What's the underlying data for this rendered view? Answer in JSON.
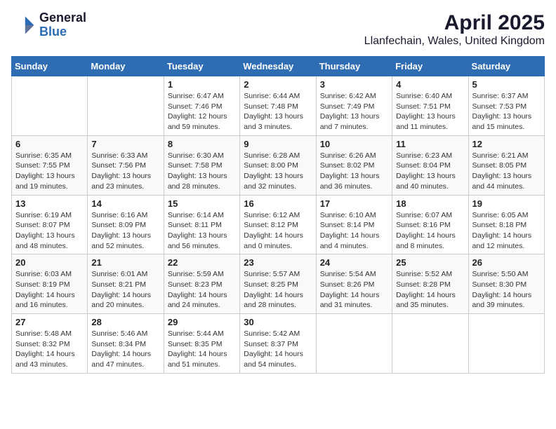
{
  "logo": {
    "general": "General",
    "blue": "Blue"
  },
  "title": "April 2025",
  "subtitle": "Llanfechain, Wales, United Kingdom",
  "days_header": [
    "Sunday",
    "Monday",
    "Tuesday",
    "Wednesday",
    "Thursday",
    "Friday",
    "Saturday"
  ],
  "weeks": [
    [
      {
        "day": "",
        "info": ""
      },
      {
        "day": "",
        "info": ""
      },
      {
        "day": "1",
        "info": "Sunrise: 6:47 AM\nSunset: 7:46 PM\nDaylight: 12 hours\nand 59 minutes."
      },
      {
        "day": "2",
        "info": "Sunrise: 6:44 AM\nSunset: 7:48 PM\nDaylight: 13 hours\nand 3 minutes."
      },
      {
        "day": "3",
        "info": "Sunrise: 6:42 AM\nSunset: 7:49 PM\nDaylight: 13 hours\nand 7 minutes."
      },
      {
        "day": "4",
        "info": "Sunrise: 6:40 AM\nSunset: 7:51 PM\nDaylight: 13 hours\nand 11 minutes."
      },
      {
        "day": "5",
        "info": "Sunrise: 6:37 AM\nSunset: 7:53 PM\nDaylight: 13 hours\nand 15 minutes."
      }
    ],
    [
      {
        "day": "6",
        "info": "Sunrise: 6:35 AM\nSunset: 7:55 PM\nDaylight: 13 hours\nand 19 minutes."
      },
      {
        "day": "7",
        "info": "Sunrise: 6:33 AM\nSunset: 7:56 PM\nDaylight: 13 hours\nand 23 minutes."
      },
      {
        "day": "8",
        "info": "Sunrise: 6:30 AM\nSunset: 7:58 PM\nDaylight: 13 hours\nand 28 minutes."
      },
      {
        "day": "9",
        "info": "Sunrise: 6:28 AM\nSunset: 8:00 PM\nDaylight: 13 hours\nand 32 minutes."
      },
      {
        "day": "10",
        "info": "Sunrise: 6:26 AM\nSunset: 8:02 PM\nDaylight: 13 hours\nand 36 minutes."
      },
      {
        "day": "11",
        "info": "Sunrise: 6:23 AM\nSunset: 8:04 PM\nDaylight: 13 hours\nand 40 minutes."
      },
      {
        "day": "12",
        "info": "Sunrise: 6:21 AM\nSunset: 8:05 PM\nDaylight: 13 hours\nand 44 minutes."
      }
    ],
    [
      {
        "day": "13",
        "info": "Sunrise: 6:19 AM\nSunset: 8:07 PM\nDaylight: 13 hours\nand 48 minutes."
      },
      {
        "day": "14",
        "info": "Sunrise: 6:16 AM\nSunset: 8:09 PM\nDaylight: 13 hours\nand 52 minutes."
      },
      {
        "day": "15",
        "info": "Sunrise: 6:14 AM\nSunset: 8:11 PM\nDaylight: 13 hours\nand 56 minutes."
      },
      {
        "day": "16",
        "info": "Sunrise: 6:12 AM\nSunset: 8:12 PM\nDaylight: 14 hours\nand 0 minutes."
      },
      {
        "day": "17",
        "info": "Sunrise: 6:10 AM\nSunset: 8:14 PM\nDaylight: 14 hours\nand 4 minutes."
      },
      {
        "day": "18",
        "info": "Sunrise: 6:07 AM\nSunset: 8:16 PM\nDaylight: 14 hours\nand 8 minutes."
      },
      {
        "day": "19",
        "info": "Sunrise: 6:05 AM\nSunset: 8:18 PM\nDaylight: 14 hours\nand 12 minutes."
      }
    ],
    [
      {
        "day": "20",
        "info": "Sunrise: 6:03 AM\nSunset: 8:19 PM\nDaylight: 14 hours\nand 16 minutes."
      },
      {
        "day": "21",
        "info": "Sunrise: 6:01 AM\nSunset: 8:21 PM\nDaylight: 14 hours\nand 20 minutes."
      },
      {
        "day": "22",
        "info": "Sunrise: 5:59 AM\nSunset: 8:23 PM\nDaylight: 14 hours\nand 24 minutes."
      },
      {
        "day": "23",
        "info": "Sunrise: 5:57 AM\nSunset: 8:25 PM\nDaylight: 14 hours\nand 28 minutes."
      },
      {
        "day": "24",
        "info": "Sunrise: 5:54 AM\nSunset: 8:26 PM\nDaylight: 14 hours\nand 31 minutes."
      },
      {
        "day": "25",
        "info": "Sunrise: 5:52 AM\nSunset: 8:28 PM\nDaylight: 14 hours\nand 35 minutes."
      },
      {
        "day": "26",
        "info": "Sunrise: 5:50 AM\nSunset: 8:30 PM\nDaylight: 14 hours\nand 39 minutes."
      }
    ],
    [
      {
        "day": "27",
        "info": "Sunrise: 5:48 AM\nSunset: 8:32 PM\nDaylight: 14 hours\nand 43 minutes."
      },
      {
        "day": "28",
        "info": "Sunrise: 5:46 AM\nSunset: 8:34 PM\nDaylight: 14 hours\nand 47 minutes."
      },
      {
        "day": "29",
        "info": "Sunrise: 5:44 AM\nSunset: 8:35 PM\nDaylight: 14 hours\nand 51 minutes."
      },
      {
        "day": "30",
        "info": "Sunrise: 5:42 AM\nSunset: 8:37 PM\nDaylight: 14 hours\nand 54 minutes."
      },
      {
        "day": "",
        "info": ""
      },
      {
        "day": "",
        "info": ""
      },
      {
        "day": "",
        "info": ""
      }
    ]
  ]
}
